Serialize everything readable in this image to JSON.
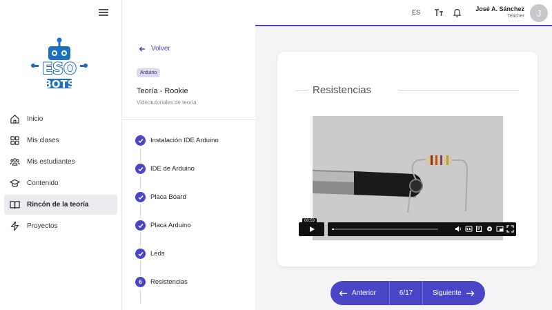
{
  "sidebar": {
    "logo_text_top": "ESO",
    "logo_text_bottom": "BOTS",
    "items": [
      {
        "label": "Inicio",
        "icon": "home-icon"
      },
      {
        "label": "Mis clases",
        "icon": "grid-icon"
      },
      {
        "label": "Mis estudiantes",
        "icon": "users-icon"
      },
      {
        "label": "Contenido",
        "icon": "graduation-cap-icon"
      },
      {
        "label": "Rincón de la teoría",
        "icon": "book-icon",
        "active": true
      },
      {
        "label": "Proyectos",
        "icon": "bolt-icon"
      }
    ]
  },
  "course": {
    "back_label": "Volver",
    "tag": "Arduino",
    "title": "Teoría - Rookie",
    "subtitle": "Videotutoriales de teoría",
    "steps": [
      {
        "label": "Instalación IDE Arduino",
        "done": true
      },
      {
        "label": "IDE de Arduino",
        "done": true
      },
      {
        "label": "Placa Board",
        "done": true
      },
      {
        "label": "Placa Arduino",
        "done": true
      },
      {
        "label": "Leds",
        "done": true
      },
      {
        "label": "Resistencias",
        "number": "6",
        "done": false
      }
    ]
  },
  "topbar": {
    "language": "ES",
    "user_name": "José A. Sánchez",
    "user_role": "Teacher",
    "avatar_initial": "J"
  },
  "lesson": {
    "title": "Resistencias",
    "video_time": "00:53",
    "progress": 0.02
  },
  "pager": {
    "prev_label": "Anterior",
    "count": "6/17",
    "next_label": "Siguiente"
  },
  "colors": {
    "accent": "#4a45c7",
    "tag_bg": "#dcd9f7",
    "logo_blue": "#1f6fc1"
  }
}
